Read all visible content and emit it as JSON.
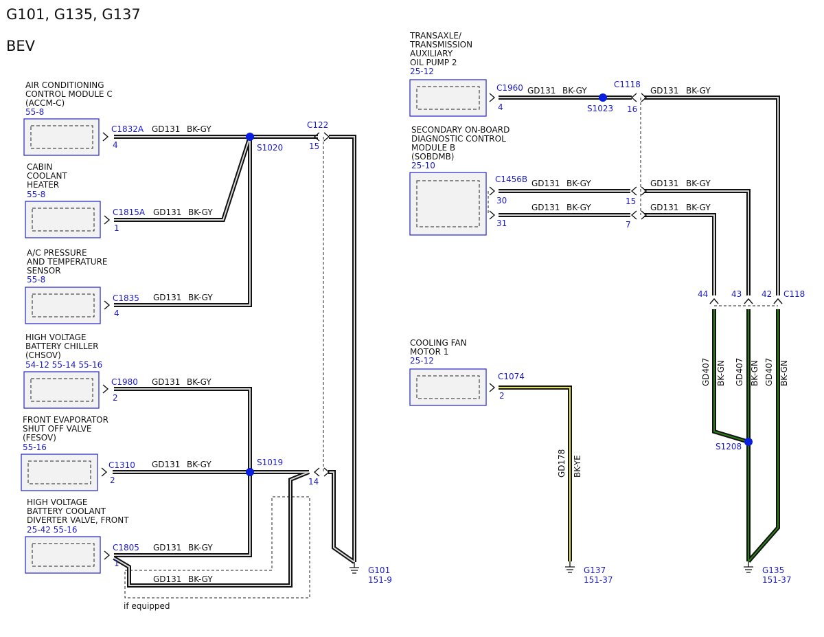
{
  "header": {
    "title": "G101, G135, G137",
    "subtitle": "BEV"
  },
  "modules": {
    "accm": {
      "lines": [
        "AIR CONDITIONING",
        "CONTROL MODULE C",
        "(ACCM-C)"
      ],
      "ref": "55-8"
    },
    "cch": {
      "lines": [
        "CABIN",
        "COOLANT",
        "HEATER"
      ],
      "ref": "55-8"
    },
    "acps": {
      "lines": [
        "A/C PRESSURE",
        "AND TEMPERATURE",
        "SENSOR"
      ],
      "ref": "55-8"
    },
    "chsov": {
      "lines": [
        "HIGH VOLTAGE",
        "BATTERY CHILLER",
        "(CHSOV)"
      ],
      "ref": "54-12 55-14  55-16"
    },
    "fesov": {
      "lines": [
        "FRONT EVAPORATOR",
        "SHUT OFF VALVE",
        "(FESOV)"
      ],
      "ref": "55-16"
    },
    "hvbcdv": {
      "lines": [
        "HIGH VOLTAGE",
        "BATTERY COOLANT",
        "DIVERTER VALVE, FRONT"
      ],
      "ref": "25-42 55-16"
    },
    "taop": {
      "lines": [
        "TRANSAXLE/",
        "TRANSMISSION",
        "AUXILIARY",
        "OIL PUMP 2"
      ],
      "ref": "25-12"
    },
    "sobdmb": {
      "lines": [
        "SECONDARY ON-BOARD",
        "DIAGNOSTIC CONTROL",
        "MODULE B",
        "(SOBDMB)"
      ],
      "ref": "25-10"
    },
    "cfm": {
      "lines": [
        "COOLING FAN",
        "MOTOR 1"
      ],
      "ref": "25-12"
    }
  },
  "connectors": {
    "c1832a": {
      "id": "C1832A",
      "pin": "4"
    },
    "c1815a": {
      "id": "C1815A",
      "pin": "1"
    },
    "c1835": {
      "id": "C1835",
      "pin": "4"
    },
    "c1980": {
      "id": "C1980",
      "pin": "2"
    },
    "c1310": {
      "id": "C1310",
      "pin": "2"
    },
    "c1805": {
      "id": "C1805",
      "pin": "1"
    },
    "c122": {
      "id": "C122",
      "pin_a": "15",
      "pin_b": "14"
    },
    "c1960": {
      "id": "C1960",
      "pin": "4"
    },
    "c1118": {
      "id": "C1118",
      "pin_a": "16",
      "pin_b": "15",
      "pin_c": "7"
    },
    "c1456b": {
      "id": "C1456B",
      "pin_a": "30",
      "pin_b": "31"
    },
    "c118": {
      "id": "C118",
      "pin_a": "44",
      "pin_b": "43",
      "pin_c": "42"
    },
    "c1074": {
      "id": "C1074",
      "pin": "2"
    }
  },
  "splices": {
    "s1020": "S1020",
    "s1019": "S1019",
    "s1023": "S1023",
    "s1208": "S1208"
  },
  "circuits": {
    "gd131": "GD131",
    "bkgy": "BK-GY",
    "gd407": "GD407",
    "bkgn": "BK-GN",
    "gd178": "GD178",
    "bkye": "BK-YE"
  },
  "grounds": {
    "g101": {
      "id": "G101",
      "ref": "151-9"
    },
    "g137": {
      "id": "G137",
      "ref": "151-37"
    },
    "g135": {
      "id": "G135",
      "ref": "151-37"
    }
  },
  "note": "if equipped",
  "colors": {
    "accent": "#1a1acc",
    "splice": "#0a1ee0",
    "wire_green": "#2e7d16",
    "wire_yellow": "#e8e83a"
  }
}
